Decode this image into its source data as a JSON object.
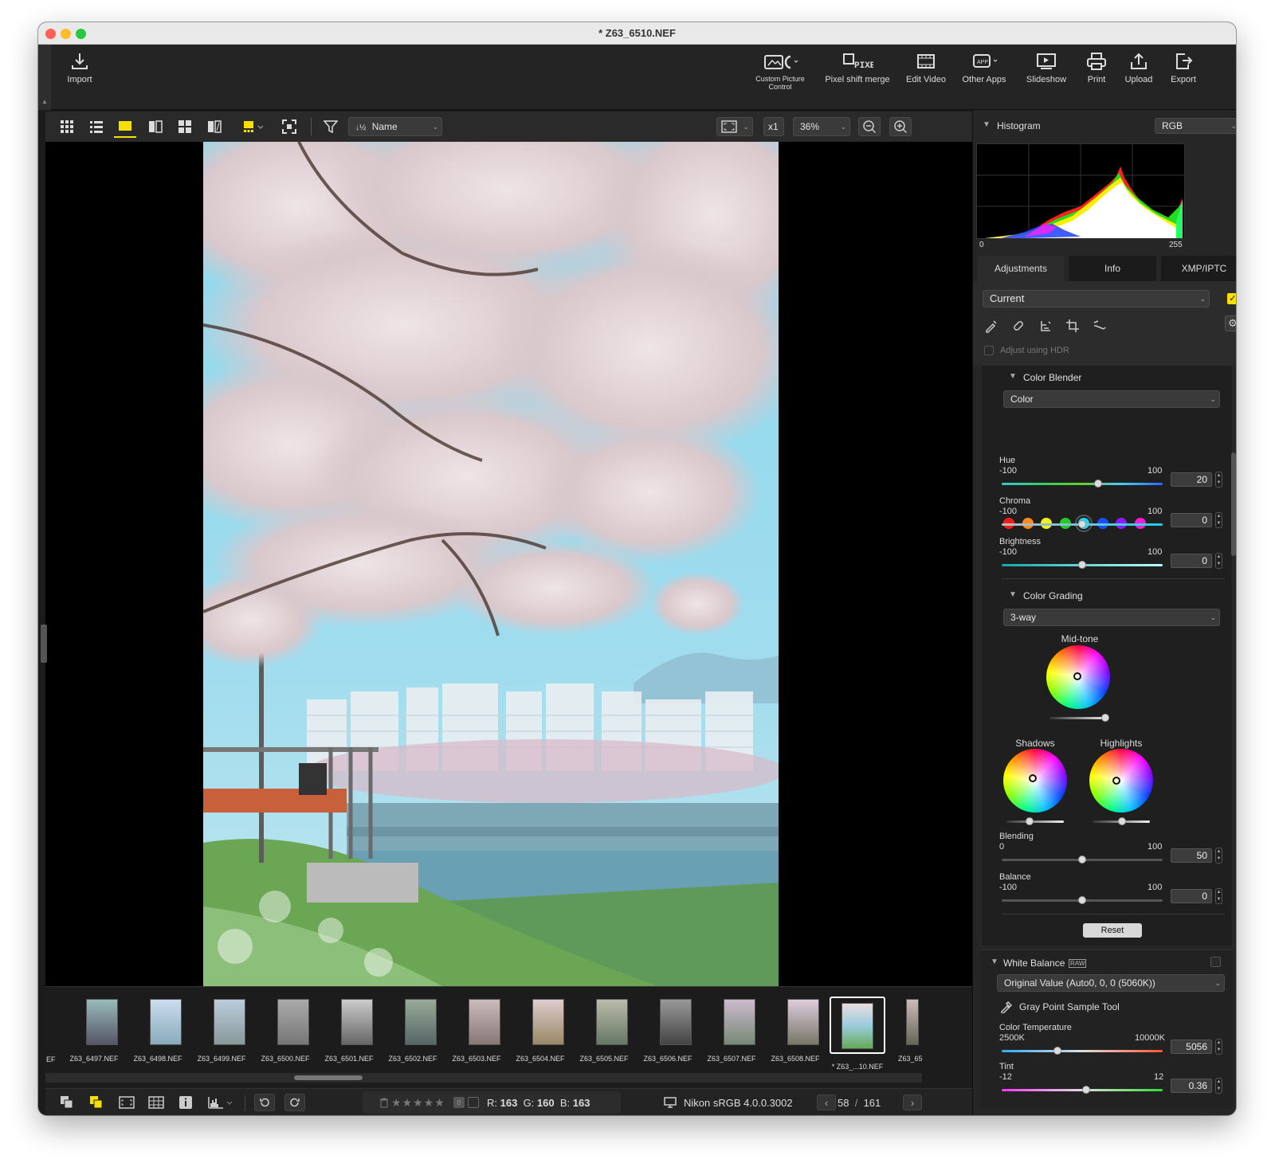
{
  "window": {
    "title": "* Z63_6510.NEF"
  },
  "toolbar": {
    "import": "Import",
    "custom_picture_control": "Custom Picture Control",
    "pixel_shift_merge": "Pixel shift merge",
    "edit_video": "Edit Video",
    "other_apps": "Other Apps",
    "slideshow": "Slideshow",
    "print": "Print",
    "upload": "Upload",
    "export": "Export"
  },
  "viewbar": {
    "sort_value": "Name",
    "magnify_x": "x1",
    "zoom": "36%"
  },
  "filmstrip": {
    "items": [
      {
        "name": "Z63_6497.NEF",
        "selected": false
      },
      {
        "name": "Z63_6498.NEF",
        "selected": false
      },
      {
        "name": "Z63_6499.NEF",
        "selected": false
      },
      {
        "name": "Z63_6500.NEF",
        "selected": false
      },
      {
        "name": "Z63_6501.NEF",
        "selected": false
      },
      {
        "name": "Z63_6502.NEF",
        "selected": false
      },
      {
        "name": "Z63_6503.NEF",
        "selected": false
      },
      {
        "name": "Z63_6504.NEF",
        "selected": false
      },
      {
        "name": "Z63_6505.NEF",
        "selected": false
      },
      {
        "name": "Z63_6506.NEF",
        "selected": false
      },
      {
        "name": "Z63_6507.NEF",
        "selected": false
      },
      {
        "name": "Z63_6508.NEF",
        "selected": false
      },
      {
        "name": "* Z63_...10.NEF",
        "selected": true
      },
      {
        "name": "Z63_65",
        "selected": false
      }
    ],
    "left_cut": "EF"
  },
  "statusbar": {
    "r_label": "R:",
    "r": "163",
    "g_label": "G:",
    "g": "160",
    "b_label": "B:",
    "b": "163",
    "profile": "Nikon sRGB 4.0.0.3002",
    "current": "58",
    "sep": "/",
    "total": "161"
  },
  "histogram": {
    "title": "Histogram",
    "channel": "RGB",
    "min": "0",
    "max": "255"
  },
  "tabs": [
    "Adjustments",
    "Info",
    "XMP/IPTC"
  ],
  "adjustments": {
    "preset": "Current",
    "hdr_label": "Adjust using HDR",
    "color_blender": {
      "title": "Color Blender",
      "mode": "Color",
      "swatches": [
        "#ff1a1a",
        "#ff8c1a",
        "#f2f21a",
        "#22cc22",
        "#1ad8f2",
        "#1a4cff",
        "#8a1aff",
        "#ff1ad8"
      ],
      "selected_swatch": 4,
      "hue": {
        "label": "Hue",
        "min": "-100",
        "max": "100",
        "value": "20",
        "fraction": 0.6
      },
      "chroma": {
        "label": "Chroma",
        "min": "-100",
        "max": "100",
        "value": "0",
        "fraction": 0.5
      },
      "brightness": {
        "label": "Brightness",
        "min": "-100",
        "max": "100",
        "value": "0",
        "fraction": 0.5
      }
    },
    "color_grading": {
      "title": "Color Grading",
      "mode": "3-way",
      "midtone_label": "Mid-tone",
      "shadows_label": "Shadows",
      "highlights_label": "Highlights",
      "blending": {
        "label": "Blending",
        "min": "0",
        "max": "100",
        "value": "50",
        "fraction": 0.5
      },
      "balance": {
        "label": "Balance",
        "min": "-100",
        "max": "100",
        "value": "0",
        "fraction": 0.5
      },
      "reset": "Reset"
    },
    "white_balance": {
      "title": "White Balance",
      "raw_badge": "RAW",
      "value": "Original Value (Auto0, 0, 0 (5060K))",
      "gray_point": "Gray Point Sample Tool",
      "color_temp": {
        "label": "Color Temperature",
        "min": "2500K",
        "max": "10000K",
        "value": "5056"
      },
      "tint": {
        "label": "Tint",
        "min": "-12",
        "max": "12",
        "value": "0.36"
      }
    }
  },
  "colors": {
    "accent": "#f5e000",
    "panel": "#262626",
    "background": "#1b1b1b"
  }
}
